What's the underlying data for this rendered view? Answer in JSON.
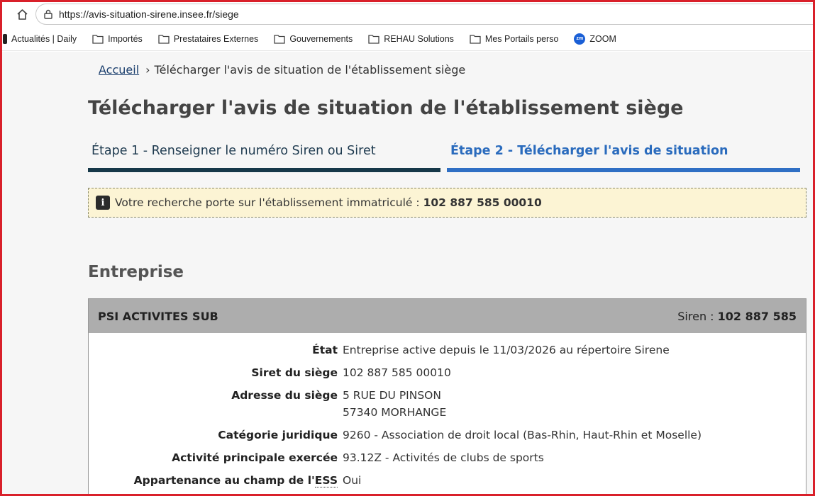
{
  "browser": {
    "url": "https://avis-situation-sirene.insee.fr/siege",
    "bookmarks": [
      {
        "label": "Actualités | Daily",
        "icon": "bookmark-icon"
      },
      {
        "label": "Importés",
        "icon": "folder-icon"
      },
      {
        "label": "Prestataires Externes",
        "icon": "folder-icon"
      },
      {
        "label": "Gouvernements",
        "icon": "folder-icon"
      },
      {
        "label": "REHAU Solutions",
        "icon": "folder-icon"
      },
      {
        "label": "Mes Portails perso",
        "icon": "folder-icon"
      },
      {
        "label": "ZOOM",
        "icon": "zoom-icon"
      }
    ]
  },
  "breadcrumb": {
    "home": "Accueil",
    "separator": "›",
    "current": "Télécharger l'avis de situation de l'établissement siège"
  },
  "page": {
    "title": "Télécharger l'avis de situation de l'établissement siège",
    "steps": [
      {
        "label": "Étape 1 - Renseigner le numéro Siren ou Siret",
        "state": "done"
      },
      {
        "label": "Étape 2 - Télécharger l'avis de situation",
        "state": "active"
      }
    ],
    "info_text": "Votre recherche porte sur l'établissement immatriculé :",
    "info_value": "102 887 585 00010",
    "section_title": "Entreprise"
  },
  "entreprise": {
    "name": "PSI ACTIVITES SUB",
    "siren_label": "Siren :",
    "siren_value": "102 887 585",
    "rows": [
      {
        "label": "État",
        "value": [
          "Entreprise active depuis le 11/03/2026 au répertoire Sirene"
        ]
      },
      {
        "label": "Siret du siège",
        "value": [
          "102 887 585 00010"
        ]
      },
      {
        "label": "Adresse du siège",
        "value": [
          "5 RUE DU PINSON",
          "57340 MORHANGE"
        ]
      },
      {
        "label": "Catégorie juridique",
        "value": [
          "9260 - Association de droit local (Bas-Rhin, Haut-Rhin et Moselle)"
        ]
      },
      {
        "label": "Activité principale exercée",
        "value": [
          "93.12Z - Activités de clubs de sports"
        ]
      },
      {
        "label_prefix": "Appartenance au champ de l'",
        "label_abbr": "ESS",
        "value": [
          "Oui"
        ]
      }
    ]
  },
  "colors": {
    "frame": "#d9202a",
    "step_done": "#163849",
    "step_active": "#2f6fc4",
    "info_bg": "#fcf4d4",
    "card_header": "#adadad"
  }
}
